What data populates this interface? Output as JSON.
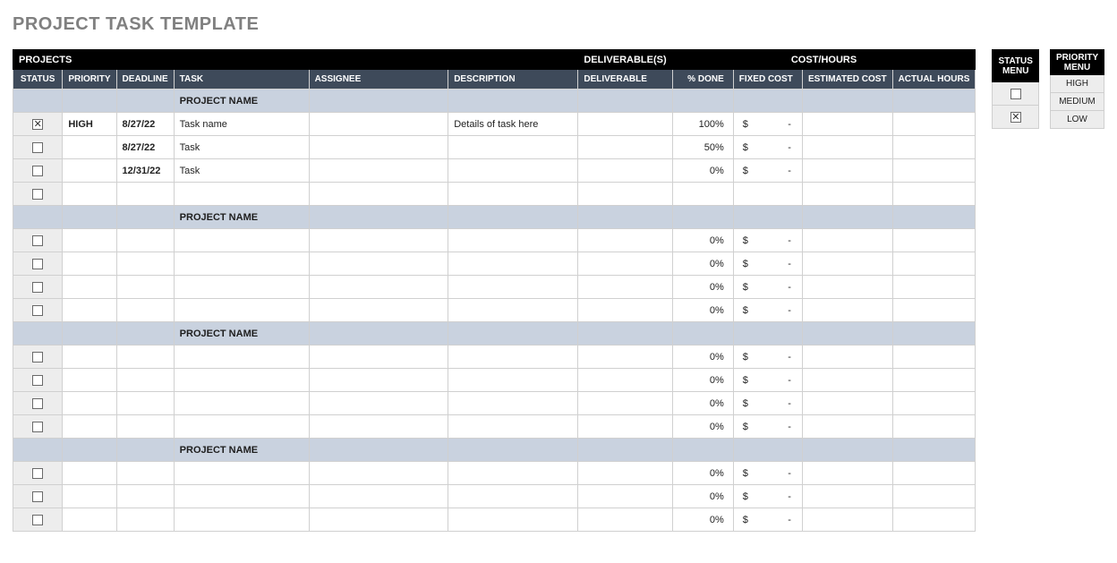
{
  "title": "PROJECT TASK TEMPLATE",
  "band": {
    "projects": "PROJECTS",
    "deliverables": "DELIVERABLE(S)",
    "cost_hours": "COST/HOURS"
  },
  "columns": {
    "status": "STATUS",
    "priority": "PRIORITY",
    "deadline": "DEADLINE",
    "task": "TASK",
    "assignee": "ASSIGNEE",
    "description": "DESCRIPTION",
    "deliverable": "DELIVERABLE",
    "pct_done": "% DONE",
    "fixed_cost": "FIXED COST",
    "estimated_cost": "ESTIMATED COST",
    "actual_hours": "ACTUAL HOURS"
  },
  "currency": "$",
  "project_name_label": "PROJECT NAME",
  "groups": [
    {
      "rows": [
        {
          "status_checked": true,
          "priority": "HIGH",
          "deadline": "8/27/22",
          "task": "Task name",
          "assignee": "",
          "description": "Details of task here",
          "deliverable": "",
          "pct_done": "100%",
          "fixed_cost_dash": "-",
          "estimated_cost": "",
          "actual_hours": ""
        },
        {
          "status_checked": false,
          "priority": "",
          "deadline": "8/27/22",
          "task": "Task",
          "assignee": "",
          "description": "",
          "deliverable": "",
          "pct_done": "50%",
          "fixed_cost_dash": "-",
          "estimated_cost": "",
          "actual_hours": ""
        },
        {
          "status_checked": false,
          "priority": "",
          "deadline": "12/31/22",
          "task": "Task",
          "assignee": "",
          "description": "",
          "deliverable": "",
          "pct_done": "0%",
          "fixed_cost_dash": "-",
          "estimated_cost": "",
          "actual_hours": ""
        },
        {
          "status_checked": false,
          "priority": "",
          "deadline": "",
          "task": "",
          "assignee": "",
          "description": "",
          "deliverable": "",
          "pct_done": "",
          "fixed_cost_dash": "",
          "estimated_cost": "",
          "actual_hours": ""
        }
      ]
    },
    {
      "rows": [
        {
          "status_checked": false,
          "priority": "",
          "deadline": "",
          "task": "",
          "assignee": "",
          "description": "",
          "deliverable": "",
          "pct_done": "0%",
          "fixed_cost_dash": "-",
          "estimated_cost": "",
          "actual_hours": ""
        },
        {
          "status_checked": false,
          "priority": "",
          "deadline": "",
          "task": "",
          "assignee": "",
          "description": "",
          "deliverable": "",
          "pct_done": "0%",
          "fixed_cost_dash": "-",
          "estimated_cost": "",
          "actual_hours": ""
        },
        {
          "status_checked": false,
          "priority": "",
          "deadline": "",
          "task": "",
          "assignee": "",
          "description": "",
          "deliverable": "",
          "pct_done": "0%",
          "fixed_cost_dash": "-",
          "estimated_cost": "",
          "actual_hours": ""
        },
        {
          "status_checked": false,
          "priority": "",
          "deadline": "",
          "task": "",
          "assignee": "",
          "description": "",
          "deliverable": "",
          "pct_done": "0%",
          "fixed_cost_dash": "-",
          "estimated_cost": "",
          "actual_hours": ""
        }
      ]
    },
    {
      "rows": [
        {
          "status_checked": false,
          "priority": "",
          "deadline": "",
          "task": "",
          "assignee": "",
          "description": "",
          "deliverable": "",
          "pct_done": "0%",
          "fixed_cost_dash": "-",
          "estimated_cost": "",
          "actual_hours": ""
        },
        {
          "status_checked": false,
          "priority": "",
          "deadline": "",
          "task": "",
          "assignee": "",
          "description": "",
          "deliverable": "",
          "pct_done": "0%",
          "fixed_cost_dash": "-",
          "estimated_cost": "",
          "actual_hours": ""
        },
        {
          "status_checked": false,
          "priority": "",
          "deadline": "",
          "task": "",
          "assignee": "",
          "description": "",
          "deliverable": "",
          "pct_done": "0%",
          "fixed_cost_dash": "-",
          "estimated_cost": "",
          "actual_hours": ""
        },
        {
          "status_checked": false,
          "priority": "",
          "deadline": "",
          "task": "",
          "assignee": "",
          "description": "",
          "deliverable": "",
          "pct_done": "0%",
          "fixed_cost_dash": "-",
          "estimated_cost": "",
          "actual_hours": ""
        }
      ]
    },
    {
      "rows": [
        {
          "status_checked": false,
          "priority": "",
          "deadline": "",
          "task": "",
          "assignee": "",
          "description": "",
          "deliverable": "",
          "pct_done": "0%",
          "fixed_cost_dash": "-",
          "estimated_cost": "",
          "actual_hours": ""
        },
        {
          "status_checked": false,
          "priority": "",
          "deadline": "",
          "task": "",
          "assignee": "",
          "description": "",
          "deliverable": "",
          "pct_done": "0%",
          "fixed_cost_dash": "-",
          "estimated_cost": "",
          "actual_hours": ""
        },
        {
          "status_checked": false,
          "priority": "",
          "deadline": "",
          "task": "",
          "assignee": "",
          "description": "",
          "deliverable": "",
          "pct_done": "0%",
          "fixed_cost_dash": "-",
          "estimated_cost": "",
          "actual_hours": ""
        }
      ]
    }
  ],
  "status_menu": {
    "header": "STATUS MENU",
    "unchecked": false,
    "checked": true
  },
  "priority_menu": {
    "header": "PRIORITY MENU",
    "options": [
      "HIGH",
      "MEDIUM",
      "LOW"
    ]
  }
}
